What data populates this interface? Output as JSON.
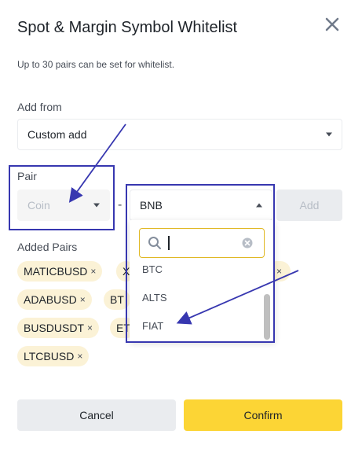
{
  "dialog": {
    "title": "Spot & Margin Symbol Whitelist",
    "subtitle": "Up to 30 pairs can be set for whitelist."
  },
  "add_from": {
    "label": "Add from",
    "value": "Custom add"
  },
  "pair": {
    "label": "Pair",
    "coin_placeholder": "Coin",
    "separator": "-",
    "quote_value": "BNB",
    "add_label": "Add"
  },
  "added_pairs": {
    "label": "Added Pairs",
    "chips": [
      "MATICBUSD",
      "X",
      "ADABUSD",
      "BT",
      "BUSDUSDT",
      "ET",
      "LTCBUSD"
    ],
    "remove_glyph": "×"
  },
  "dropdown": {
    "search_placeholder": "",
    "options": [
      "BTC",
      "ALTS",
      "FIAT"
    ]
  },
  "footer": {
    "cancel_label": "Cancel",
    "confirm_label": "Confirm"
  },
  "colors": {
    "accent": "#fcd535",
    "chip_bg": "#fbf2d6",
    "annotation": "#3737b0"
  },
  "icons": [
    "close-icon",
    "chevron-down-icon",
    "chevron-up-icon",
    "search-icon",
    "clear-icon"
  ]
}
